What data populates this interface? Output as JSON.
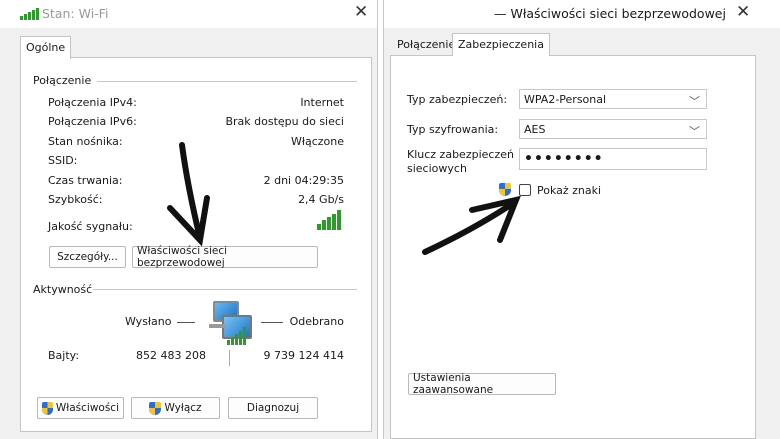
{
  "left_window": {
    "title": "Stan: Wi-Fi",
    "tab": "Ogólne",
    "connection": {
      "heading": "Połączenie",
      "rows": [
        {
          "label": "Połączenia IPv4:",
          "value": "Internet"
        },
        {
          "label": "Połączenia IPv6:",
          "value": "Brak dostępu do sieci"
        },
        {
          "label": "Stan nośnika:",
          "value": "Włączone"
        },
        {
          "label": "SSID:",
          "value": ""
        },
        {
          "label": "Czas trwania:",
          "value": "2 dni 04:29:35"
        },
        {
          "label": "Szybkość:",
          "value": "2,4 Gb/s"
        }
      ],
      "signal_label": "Jakość sygnału:",
      "details_button": "Szczegóły...",
      "wireless_props_button": "Właściwości sieci bezprzewodowej"
    },
    "activity": {
      "heading": "Aktywność",
      "sent_label": "Wysłano",
      "received_label": "Odebrano",
      "bytes_label": "Bajty:",
      "bytes_sent": "852 483 208",
      "bytes_received": "9 739 124 414"
    },
    "buttons": {
      "properties": "Właściwości",
      "disable": "Wyłącz",
      "diagnose": "Diagnozuj"
    }
  },
  "right_window": {
    "title": "— Właściwości sieci bezprzewodowej",
    "tabs": [
      "Połączenie",
      "Zabezpieczenia"
    ],
    "active_tab": "Zabezpieczenia",
    "security_type_label": "Typ zabezpieczeń:",
    "security_type_value": "WPA2-Personal",
    "encryption_label": "Typ szyfrowania:",
    "encryption_value": "AES",
    "key_label_line1": "Klucz zabezpieczeń",
    "key_label_line2": "sieciowych",
    "key_value": "••••••••",
    "show_chars_label": "Pokaż znaki",
    "advanced_button": "Ustawienia zaawansowane"
  },
  "colors": {
    "signal_green": "#2e9a2e",
    "arrow": "#111111",
    "window_bg": "#f0f0f0"
  }
}
